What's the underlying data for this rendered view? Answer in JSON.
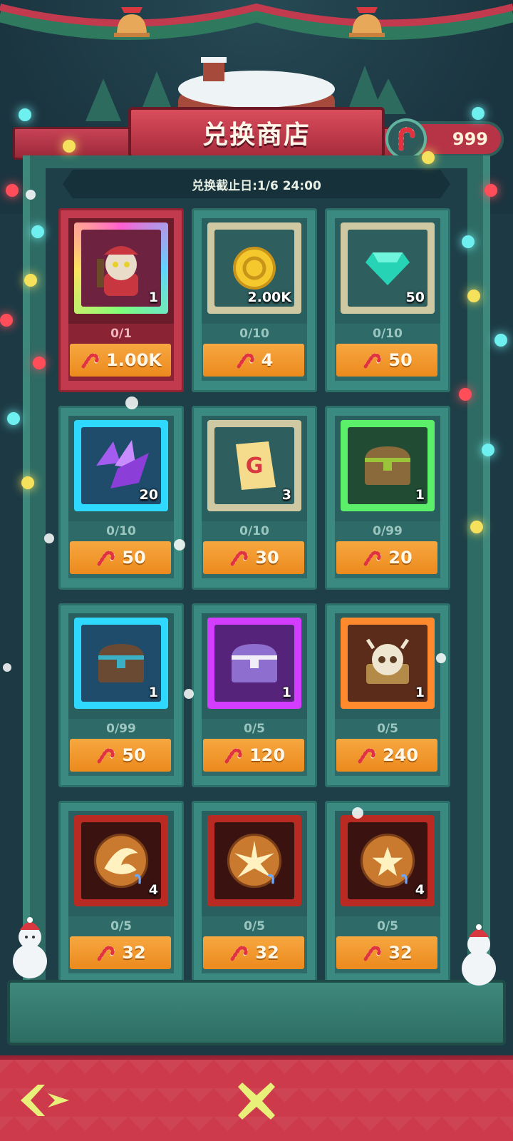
{
  "shop": {
    "title": "兑换商店",
    "deadline": "兑换截止日:1/6 24:00"
  },
  "currency": {
    "icon": "candy-cane-icon",
    "amount": "999"
  },
  "items": [
    {
      "icon": "santa-hero-icon",
      "quantity": "1",
      "limit": "0/1",
      "price": "1.00K",
      "frame": "rainbow",
      "featured": true
    },
    {
      "icon": "gold-coin-icon",
      "quantity": "2.00K",
      "limit": "0/10",
      "price": "4",
      "frame": "beige"
    },
    {
      "icon": "diamond-gem-icon",
      "quantity": "50",
      "limit": "0/10",
      "price": "50",
      "frame": "beige"
    },
    {
      "icon": "purple-crystal-shard-icon",
      "quantity": "20",
      "limit": "0/10",
      "price": "50",
      "frame": "blue"
    },
    {
      "icon": "gacha-scroll-icon",
      "quantity": "3",
      "limit": "0/10",
      "price": "30",
      "frame": "beige"
    },
    {
      "icon": "green-treasure-chest-icon",
      "quantity": "1",
      "limit": "0/99",
      "price": "20",
      "frame": "green"
    },
    {
      "icon": "blue-treasure-chest-icon",
      "quantity": "1",
      "limit": "0/99",
      "price": "50",
      "frame": "blue"
    },
    {
      "icon": "purple-treasure-chest-icon",
      "quantity": "1",
      "limit": "0/5",
      "price": "120",
      "frame": "purple"
    },
    {
      "icon": "skull-treasure-chest-icon",
      "quantity": "1",
      "limit": "0/5",
      "price": "240",
      "frame": "orange"
    },
    {
      "icon": "flame-orb-skill-icon",
      "quantity": "4",
      "limit": "0/5",
      "price": "32",
      "frame": "red"
    },
    {
      "icon": "burst-orb-skill-icon",
      "quantity": "",
      "limit": "0/5",
      "price": "32",
      "frame": "red"
    },
    {
      "icon": "star-orb-skill-icon",
      "quantity": "4",
      "limit": "0/5",
      "price": "32",
      "frame": "red"
    }
  ],
  "price_icon": "candy-cane-icon",
  "nav": {
    "back_icon": "back-arrow-icon",
    "close_icon": "close-x-icon"
  },
  "colors": {
    "price_button": "#f09530",
    "card": "#3a8a82",
    "featured_card": "#c23a4d",
    "footer": "#cc3a4c",
    "accent_yellow": "#e8f07a"
  }
}
